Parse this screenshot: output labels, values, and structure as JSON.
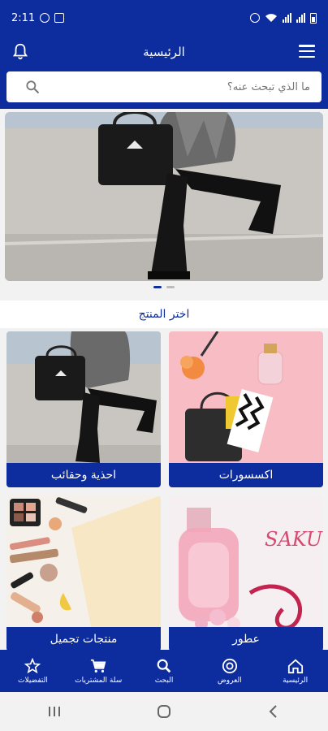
{
  "status": {
    "time": "2:11"
  },
  "header": {
    "title": "الرئيسية"
  },
  "search": {
    "placeholder": "ما الذي تبحث عنه؟"
  },
  "section": {
    "title": "اختر المنتج"
  },
  "categories": [
    {
      "label": "اكسسورات"
    },
    {
      "label": "احذية وحقائب"
    },
    {
      "label": "عطور"
    },
    {
      "label": "منتجات تجميل"
    }
  ],
  "perfume_brand": "SAKU",
  "bottom_nav": [
    {
      "label": "الرئيسية",
      "icon": "home-icon"
    },
    {
      "label": "العروض",
      "icon": "offers-icon"
    },
    {
      "label": "البحث",
      "icon": "search-icon"
    },
    {
      "label": "سلة المشتريات",
      "icon": "cart-icon"
    },
    {
      "label": "التفضيلات",
      "icon": "star-icon"
    }
  ],
  "colors": {
    "primary": "#0d2c9e"
  }
}
